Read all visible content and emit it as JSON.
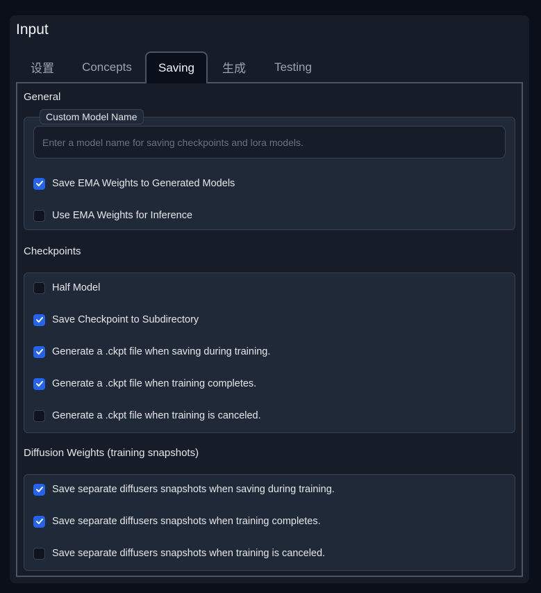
{
  "panel": {
    "title": "Input"
  },
  "tabs": [
    {
      "label": "设置"
    },
    {
      "label": "Concepts"
    },
    {
      "label": "Saving",
      "active": true
    },
    {
      "label": "生成"
    },
    {
      "label": "Testing"
    }
  ],
  "general": {
    "label": "General",
    "model_name": {
      "legend": "Custom Model Name",
      "value": "",
      "placeholder": "Enter a model name for saving checkpoints and lora models."
    },
    "checks": [
      {
        "label": "Save EMA Weights to Generated Models",
        "checked": true
      },
      {
        "label": "Use EMA Weights for Inference",
        "checked": false
      }
    ]
  },
  "checkpoints": {
    "label": "Checkpoints",
    "checks": [
      {
        "label": "Half Model",
        "checked": false
      },
      {
        "label": "Save Checkpoint to Subdirectory",
        "checked": true
      },
      {
        "label": "Generate a .ckpt file when saving during training.",
        "checked": true
      },
      {
        "label": "Generate a .ckpt file when training completes.",
        "checked": true
      },
      {
        "label": "Generate a .ckpt file when training is canceled.",
        "checked": false
      }
    ]
  },
  "diffusion": {
    "label": "Diffusion Weights (training snapshots)",
    "checks": [
      {
        "label": "Save separate diffusers snapshots when saving during training.",
        "checked": true
      },
      {
        "label": "Save separate diffusers snapshots when training completes.",
        "checked": true
      },
      {
        "label": "Save separate diffusers snapshots when training is canceled.",
        "checked": false
      }
    ]
  },
  "colors": {
    "background": "#0b0f19",
    "panel": "#161c28",
    "group": "#1f2937",
    "accent": "#2563eb",
    "border": "#374151"
  }
}
